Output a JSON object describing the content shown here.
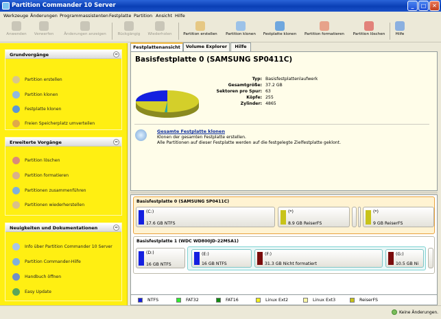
{
  "window": {
    "title": "Partition Commander 10 Server",
    "btn_min": "_",
    "btn_max": "□",
    "btn_close": "✕"
  },
  "menu": [
    "Werkzeuge",
    "Änderungen",
    "Programmassistenten",
    "Festplatte",
    "Partition",
    "Ansicht",
    "Hilfe"
  ],
  "toolbar": {
    "apply": "Anwenden",
    "discard": "Verwerfen",
    "show_changes": "Änderungen anzeigen",
    "undo": "Rückgängig",
    "redo": "Wiederholen",
    "create": "Partition erstellen",
    "clone_part": "Partition klonen",
    "clone_disk": "Festplatte klonen",
    "format": "Partition formatieren",
    "delete": "Partition löschen",
    "help": "Hilfe"
  },
  "sidebar": {
    "basic": {
      "title": "Grundvorgänge",
      "items": [
        "Partition erstellen",
        "Partition klonen",
        "Festplatte klonen",
        "Freien Speicherplatz umverteilen"
      ]
    },
    "advanced": {
      "title": "Erweiterte Vorgänge",
      "items": [
        "Partition löschen",
        "Partition formatieren",
        "Partitionen zusammenführen",
        "Partitionen wiederherstellen"
      ]
    },
    "news": {
      "title": "Neuigkeiten und Dokumentationen",
      "items": [
        "Info über Partition Commander 10 Server",
        "Partition Commander-Hilfe",
        "Handbuch öffnen",
        "Easy Update"
      ]
    },
    "chevron": "≈"
  },
  "tabs": [
    "Festplattenansicht",
    "Volume Explorer",
    "Hilfe"
  ],
  "disk": {
    "title": "Basisfestplatte 0 (SAMSUNG SP0411C)",
    "info": [
      {
        "k": "Typ:",
        "v": "Basisfestplattenlaufwerk"
      },
      {
        "k": "Gesamtgröße:",
        "v": "37.2 GB"
      },
      {
        "k": "Sektoren pro Spur:",
        "v": "63"
      },
      {
        "k": "Köpfe:",
        "v": "255"
      },
      {
        "k": "Zylinder:",
        "v": "4865"
      }
    ],
    "clone_link": "Gesamte Festplatte klonen",
    "clone_desc1": "Klonen der gesamten Festplatte erstellen.",
    "clone_desc2": "Alle Partitionen auf dieser Festplatte werden auf die festgelegte Zielfestplatte geklont."
  },
  "diskmap": {
    "disk0": {
      "title": "Basisfestplatte 0 (SAMSUNG SP0411C)",
      "parts": [
        {
          "label": "(C:)",
          "size": "17.6 GB NTFS",
          "color": "#1420e0"
        },
        {
          "label": "(*)",
          "size": "8.9 GB ReiserFS",
          "color": "#c8c31a"
        },
        {
          "label": "(*)",
          "size": "9 GB ReiserFS",
          "color": "#c8c31a"
        }
      ]
    },
    "disk1": {
      "title": "Basisfestplatte 1 (WDC WD800JD-22MSA1)",
      "parts": [
        {
          "label": "(D:)",
          "size": "16 GB NTFS",
          "color": "#1420e0"
        },
        {
          "label": "(E:)",
          "size": "16 GB NTFS",
          "color": "#1420e0"
        },
        {
          "label": "(F:)",
          "size": "31.3 GB Nicht formatiert",
          "color": "#7a0c0c"
        },
        {
          "label": "(G:)",
          "size": "10.5 GB Ni",
          "color": "#7a0c0c"
        }
      ]
    }
  },
  "legend": [
    {
      "name": "NTFS",
      "color": "#1420e0"
    },
    {
      "name": "FAT32",
      "color": "#2ff02f"
    },
    {
      "name": "FAT16",
      "color": "#118c11"
    },
    {
      "name": "Linux Ext2",
      "color": "#f4f21e"
    },
    {
      "name": "Linux Ext3",
      "color": "#fbf8a6"
    },
    {
      "name": "ReiserFS",
      "color": "#c8c31a"
    }
  ],
  "status": {
    "text": "Keine Änderungen."
  },
  "colors": {
    "accent": "#ffef12",
    "title_blue": "#0a3fb5"
  }
}
